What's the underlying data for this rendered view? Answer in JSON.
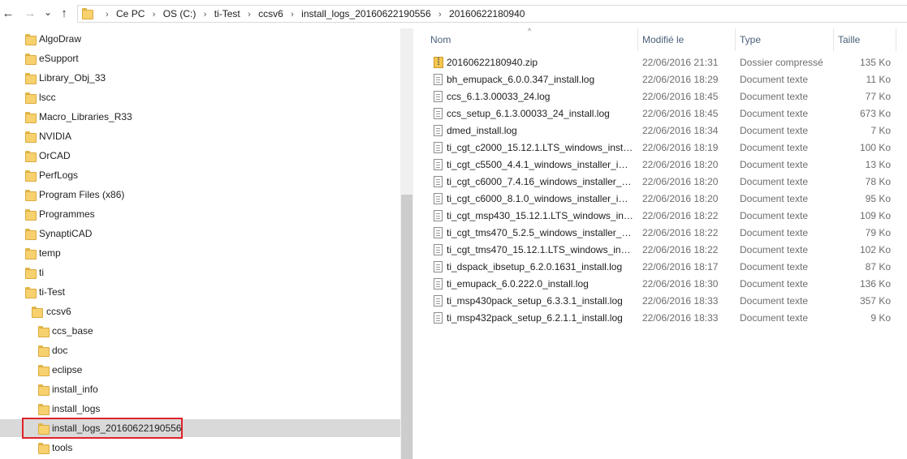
{
  "nav": {
    "back_icon": "←",
    "forward_icon": "→",
    "recent_icon": "⌄",
    "up_icon": "↑"
  },
  "address": {
    "crumbs": [
      "Ce PC",
      "OS (C:)",
      "ti-Test",
      "ccsv6",
      "install_logs_20160622190556",
      "20160622180940"
    ],
    "separator": "›"
  },
  "tree": {
    "items": [
      {
        "label": "AlgoDraw"
      },
      {
        "label": "eSupport"
      },
      {
        "label": "Library_Obj_33"
      },
      {
        "label": "lscc"
      },
      {
        "label": "Macro_Libraries_R33"
      },
      {
        "label": "NVIDIA"
      },
      {
        "label": "OrCAD"
      },
      {
        "label": "PerfLogs"
      },
      {
        "label": "Program Files (x86)"
      },
      {
        "label": "Programmes"
      },
      {
        "label": "SynaptiCAD"
      },
      {
        "label": "temp"
      },
      {
        "label": "ti"
      },
      {
        "label": "ti-Test"
      },
      {
        "label": "ccsv6"
      },
      {
        "label": "ccs_base"
      },
      {
        "label": "doc"
      },
      {
        "label": "eclipse"
      },
      {
        "label": "install_info"
      },
      {
        "label": "install_logs"
      },
      {
        "label": "install_logs_20160622190556",
        "selected": true
      },
      {
        "label": "tools"
      }
    ]
  },
  "list": {
    "columns": {
      "name": "Nom",
      "modified": "Modifié le",
      "type": "Type",
      "size": "Taille"
    },
    "sort_indicator": "^",
    "rows": [
      {
        "name": "20160622180940.zip",
        "date": "22/06/2016 21:31",
        "type": "Dossier compressé",
        "size": "135 Ko",
        "icon": "zip-icon"
      },
      {
        "name": "bh_emupack_6.0.0.347_install.log",
        "date": "22/06/2016 18:29",
        "type": "Document texte",
        "size": "11 Ko",
        "icon": "document-icon"
      },
      {
        "name": "ccs_6.1.3.00033_24.log",
        "date": "22/06/2016 18:45",
        "type": "Document texte",
        "size": "77 Ko",
        "icon": "document-icon"
      },
      {
        "name": "ccs_setup_6.1.3.00033_24_install.log",
        "date": "22/06/2016 18:45",
        "type": "Document texte",
        "size": "673 Ko",
        "icon": "document-icon"
      },
      {
        "name": "dmed_install.log",
        "date": "22/06/2016 18:34",
        "type": "Document texte",
        "size": "7 Ko",
        "icon": "document-icon"
      },
      {
        "name": "ti_cgt_c2000_15.12.1.LTS_windows_install...",
        "date": "22/06/2016 18:19",
        "type": "Document texte",
        "size": "100 Ko",
        "icon": "document-icon"
      },
      {
        "name": "ti_cgt_c5500_4.4.1_windows_installer_inst...",
        "date": "22/06/2016 18:20",
        "type": "Document texte",
        "size": "13 Ko",
        "icon": "document-icon"
      },
      {
        "name": "ti_cgt_c6000_7.4.16_windows_installer_ins...",
        "date": "22/06/2016 18:20",
        "type": "Document texte",
        "size": "78 Ko",
        "icon": "document-icon"
      },
      {
        "name": "ti_cgt_c6000_8.1.0_windows_installer_inst...",
        "date": "22/06/2016 18:20",
        "type": "Document texte",
        "size": "95 Ko",
        "icon": "document-icon"
      },
      {
        "name": "ti_cgt_msp430_15.12.1.LTS_windows_inst...",
        "date": "22/06/2016 18:22",
        "type": "Document texte",
        "size": "109 Ko",
        "icon": "document-icon"
      },
      {
        "name": "ti_cgt_tms470_5.2.5_windows_installer_inst...",
        "date": "22/06/2016 18:22",
        "type": "Document texte",
        "size": "79 Ko",
        "icon": "document-icon"
      },
      {
        "name": "ti_cgt_tms470_15.12.1.LTS_windows_insta...",
        "date": "22/06/2016 18:22",
        "type": "Document texte",
        "size": "102 Ko",
        "icon": "document-icon"
      },
      {
        "name": "ti_dspack_ibsetup_6.2.0.1631_install.log",
        "date": "22/06/2016 18:17",
        "type": "Document texte",
        "size": "87 Ko",
        "icon": "document-icon"
      },
      {
        "name": "ti_emupack_6.0.222.0_install.log",
        "date": "22/06/2016 18:30",
        "type": "Document texte",
        "size": "136 Ko",
        "icon": "document-icon"
      },
      {
        "name": "ti_msp430pack_setup_6.3.3.1_install.log",
        "date": "22/06/2016 18:33",
        "type": "Document texte",
        "size": "357 Ko",
        "icon": "document-icon"
      },
      {
        "name": "ti_msp432pack_setup_6.2.1.1_install.log",
        "date": "22/06/2016 18:33",
        "type": "Document texte",
        "size": "9 Ko",
        "icon": "document-icon"
      }
    ]
  },
  "colors": {
    "selection_row": "#d9d9d9",
    "highlight_box": "#e0222a",
    "header_text": "#4c607a",
    "folder": "#f7d16e"
  }
}
